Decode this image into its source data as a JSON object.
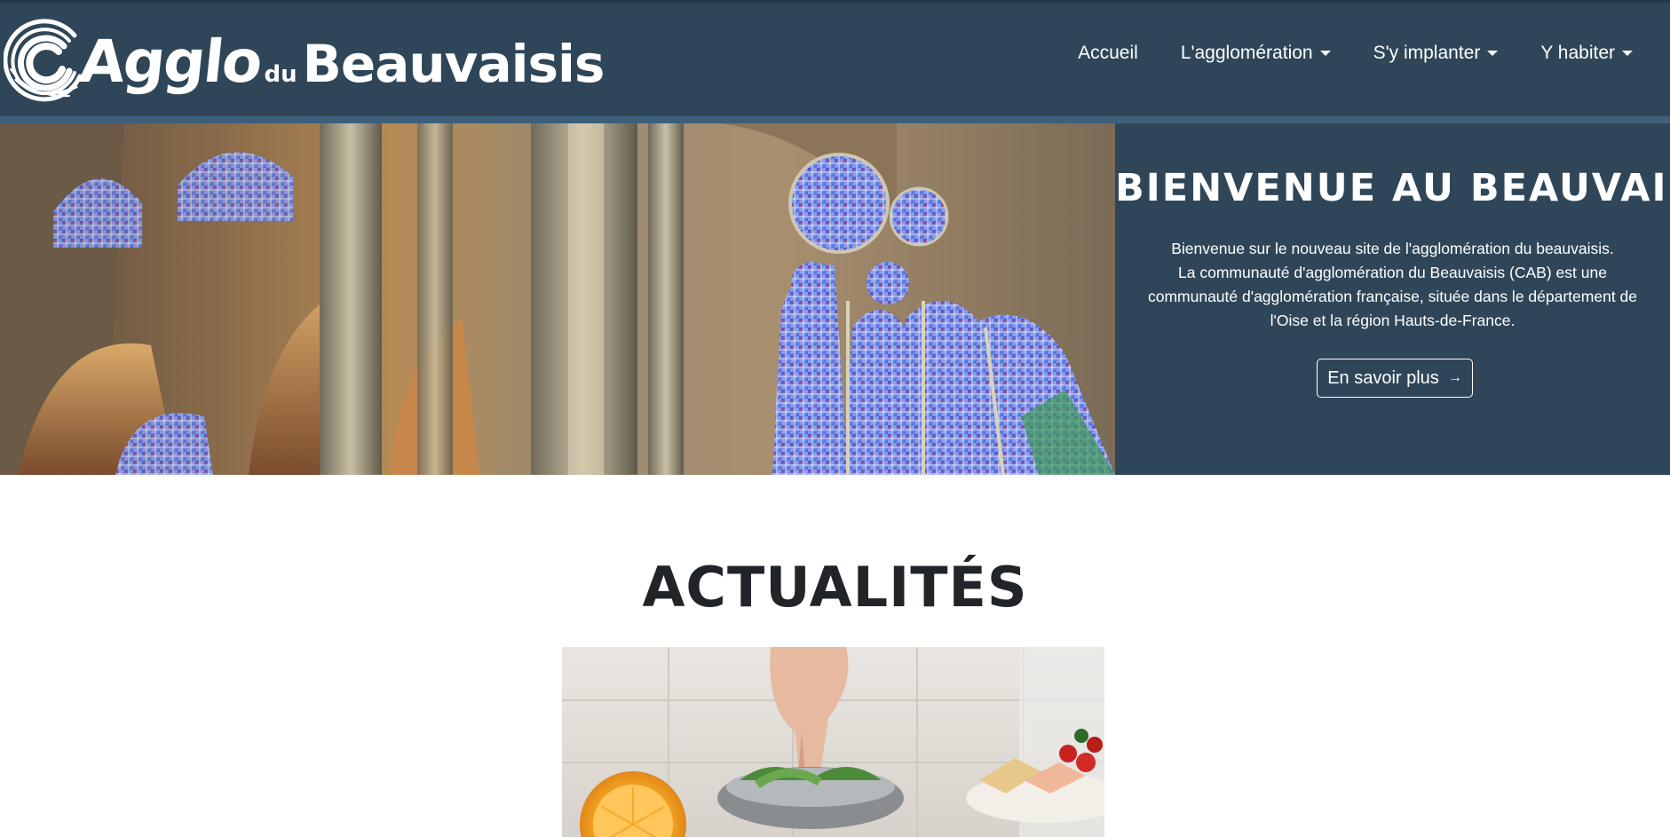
{
  "brand": {
    "logo_icon": "swirl-logo-icon",
    "name_part1": "Agglo",
    "name_part2": "du",
    "name_part3": "Beauvaisis"
  },
  "nav": {
    "items": [
      {
        "label": "Accueil",
        "has_dropdown": false
      },
      {
        "label": "L'agglomération",
        "has_dropdown": true
      },
      {
        "label": "S'y implanter",
        "has_dropdown": true
      },
      {
        "label": "Y habiter",
        "has_dropdown": true
      }
    ]
  },
  "hero": {
    "image": "cathedral-interior-stained-glass",
    "title": "BIENVENUE AU BEAUVAISIS",
    "text_line1": "Bienvenue sur le nouveau site de l'agglomération du beauvaisis.",
    "text_line2": "La communauté d'agglomération du Beauvaisis (CAB) est une communauté d'agglomération française, située dans le département de l'Oise et la région Hauts-de-France.",
    "button_label": "En savoir plus",
    "button_icon": "arrow-right-icon"
  },
  "news": {
    "title": "ACTUALITÉS",
    "card_image": "cooking-food-preparation"
  },
  "colors": {
    "navbar_bg": "#2f4658",
    "navbar_stripe": "#3d5f7b",
    "text_light": "#ffffff",
    "heading_dark": "#212529"
  }
}
